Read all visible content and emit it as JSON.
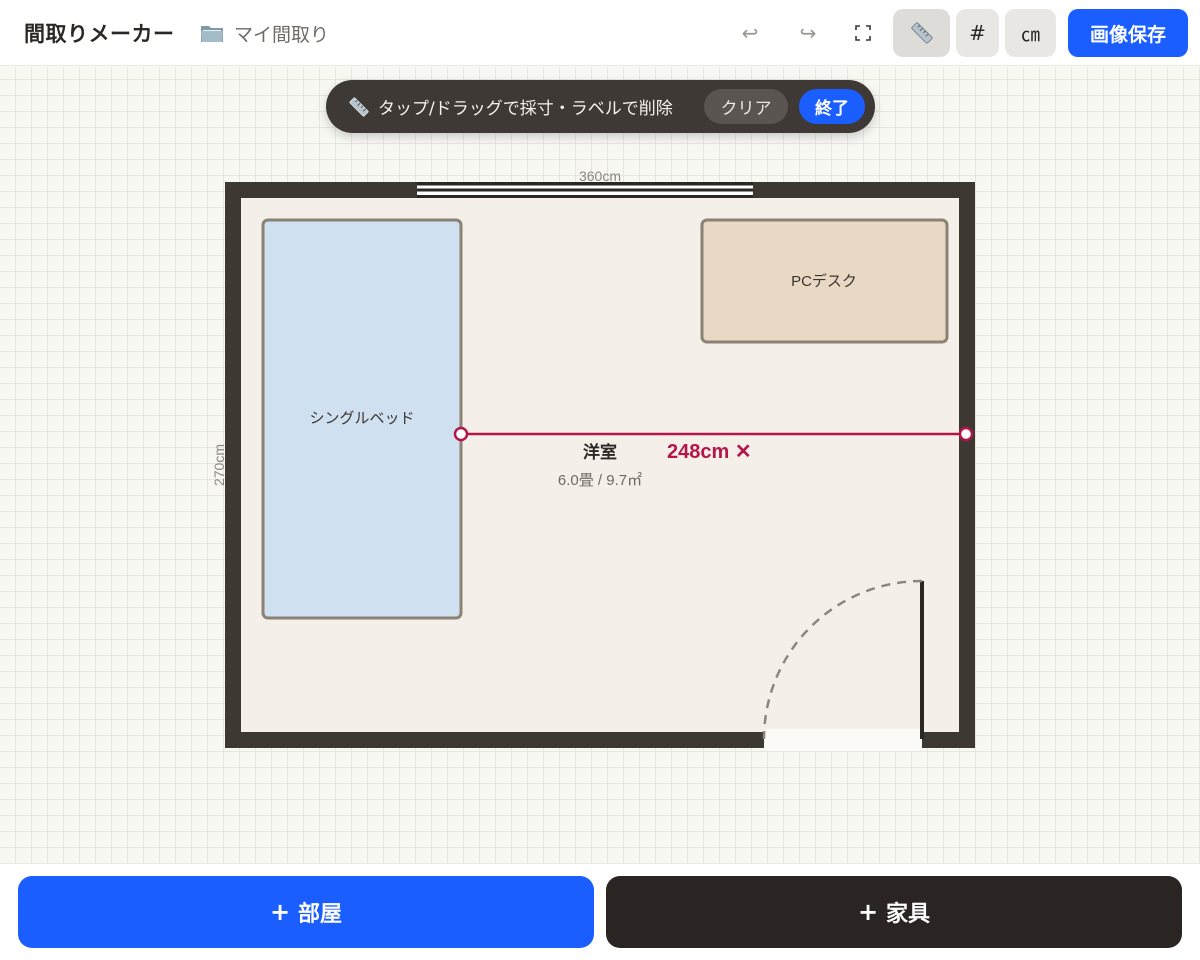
{
  "app": {
    "title": "間取りメーカー",
    "project_name": "マイ間取り"
  },
  "toolbar": {
    "undo_icon": "↩",
    "redo_icon": "↪",
    "grid_label": "#",
    "unit_label": "㎝",
    "save_label": "画像保存",
    "ruler_active": true
  },
  "measure_bar": {
    "hint": "タップ/ドラッグで採寸・ラベルで削除",
    "clear_label": "クリア",
    "done_label": "終了"
  },
  "room": {
    "name": "洋室",
    "area": "6.0畳 / 9.7㎡",
    "width_label": "360cm",
    "height_label": "270cm"
  },
  "furniture": [
    {
      "name": "シングルベッド",
      "color": "#cfe0f1"
    },
    {
      "name": "PCデスク",
      "color": "#e8d8c4"
    }
  ],
  "measurement": {
    "label": "248cm ✕",
    "color": "#b5164a"
  },
  "bottom": {
    "add_room_label": "部屋",
    "add_furniture_label": "家具",
    "plus": "+"
  },
  "colors": {
    "accent": "#1a5eff",
    "wall": "#3e3833",
    "floor": "#f4efe8",
    "dark_button": "#2a2522"
  }
}
